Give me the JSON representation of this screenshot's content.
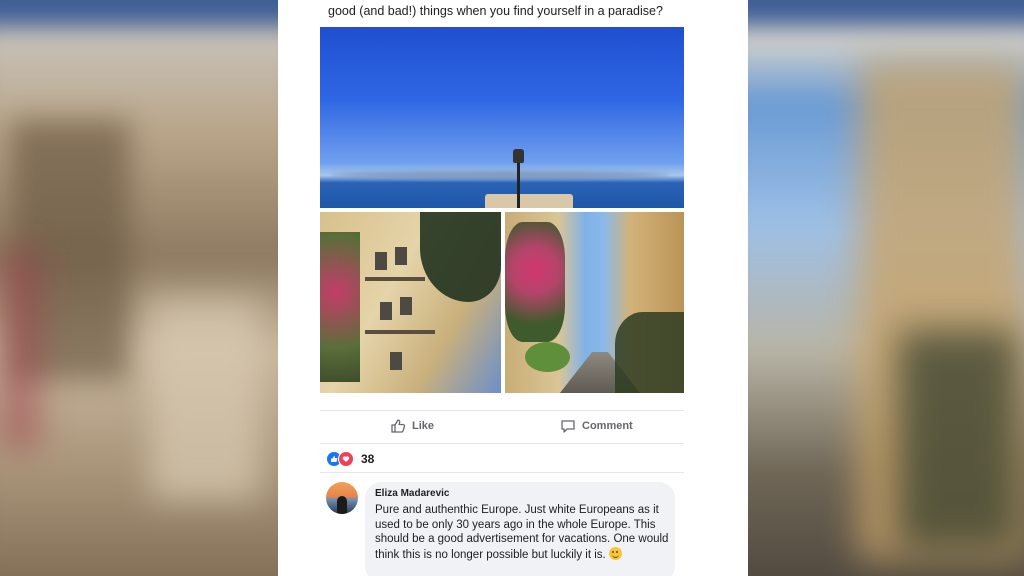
{
  "post": {
    "text": "good (and bad!) things when you find yourself in a paradise?"
  },
  "photos": [
    "seaside-lamp-photo",
    "building-flowers-photo",
    "street-flowers-photo"
  ],
  "actions": {
    "like_label": "Like",
    "comment_label": "Comment"
  },
  "reactions": {
    "count": "38",
    "types": [
      "like-icon",
      "love-icon"
    ]
  },
  "comment": {
    "author": "Eliza Madarevic",
    "text": "Pure and authenthic Europe. Just white Europeans as it used to be only 30 years ago in the whole Europe. This should be a good advertisement for vacations. One would think this is no longer possible but luckily it is."
  },
  "colors": {
    "like_blue": "#1877f2",
    "love_red": "#f33e58",
    "bubble_gray": "#f0f2f5",
    "muted_text": "#65676b"
  }
}
